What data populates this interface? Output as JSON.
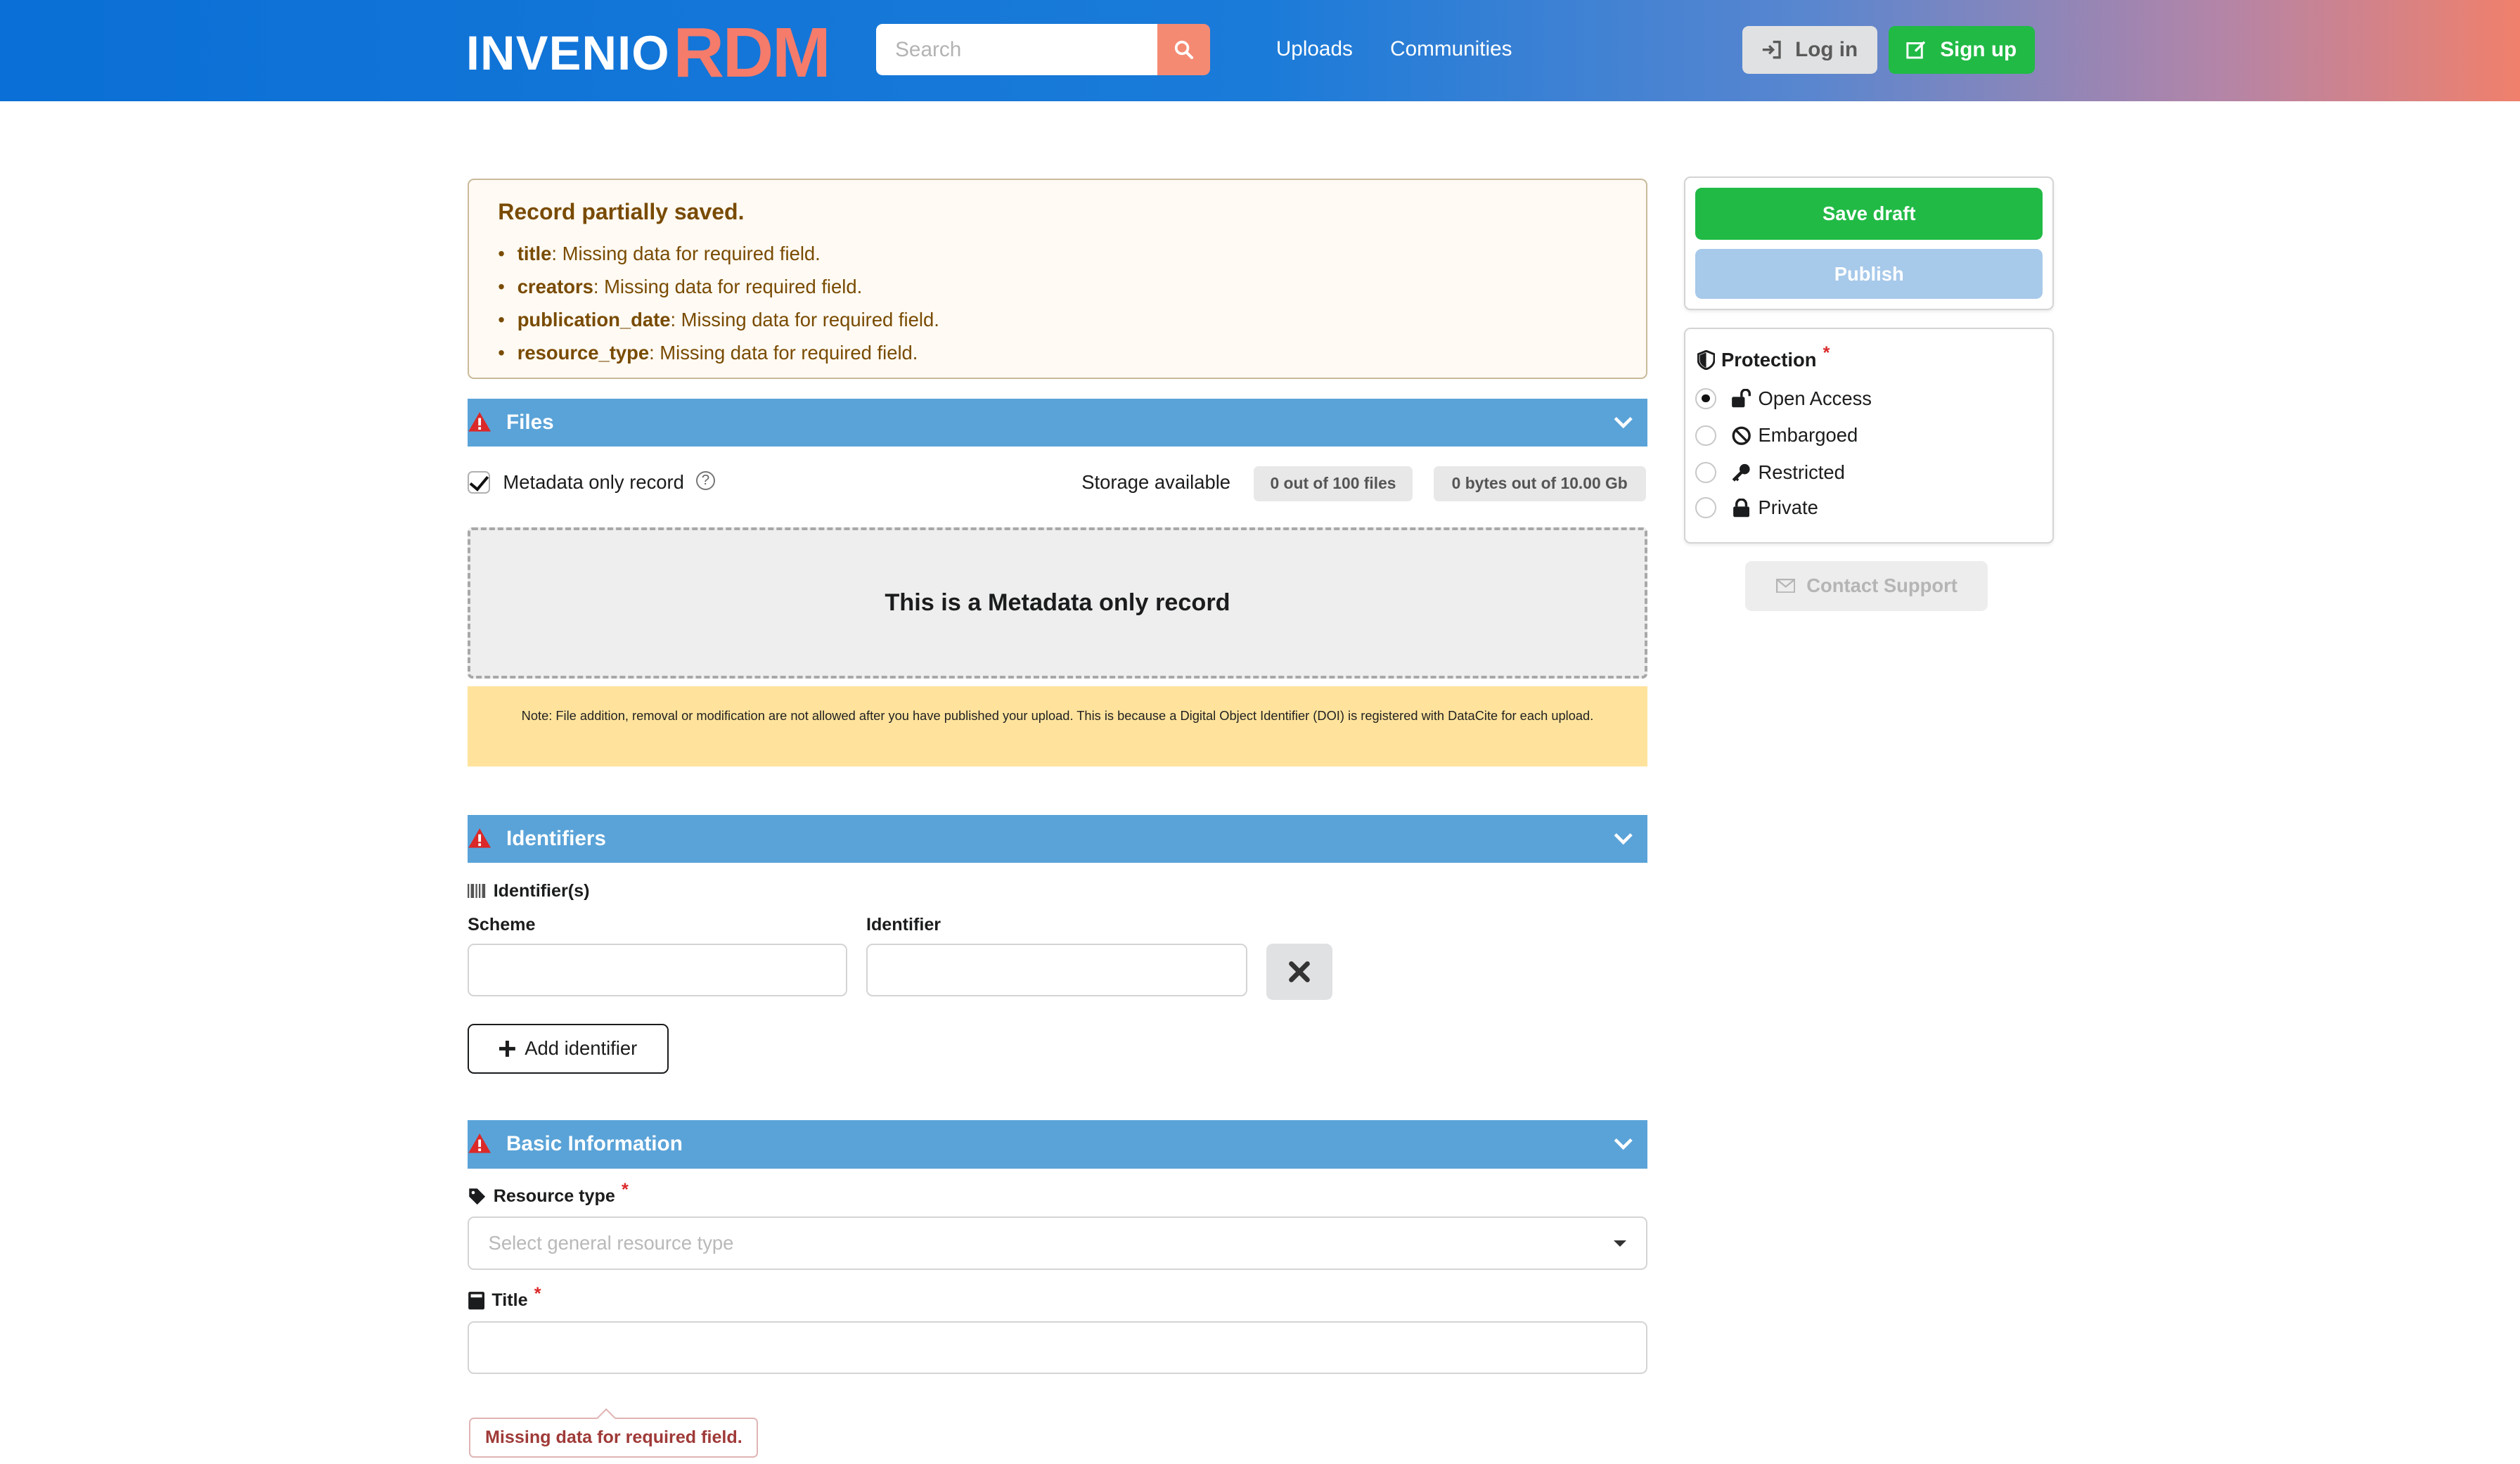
{
  "header": {
    "logo_main": "INVENIO",
    "logo_accent": "RDM",
    "search_placeholder": "Search",
    "nav": {
      "uploads": "Uploads",
      "communities": "Communities"
    },
    "login_label": "Log in",
    "signup_label": "Sign up"
  },
  "warning": {
    "title": "Record partially saved.",
    "items": [
      {
        "field": "title",
        "message": ": Missing data for required field."
      },
      {
        "field": "creators",
        "message": ": Missing data for required field."
      },
      {
        "field": "publication_date",
        "message": ": Missing data for required field."
      },
      {
        "field": "resource_type",
        "message": ": Missing data for required field."
      }
    ]
  },
  "files": {
    "section_title": "Files",
    "metadata_only_label": "Metadata only record",
    "metadata_only_checked": true,
    "storage_label": "Storage available",
    "files_chip": "0 out of 100 files",
    "size_chip": "0 bytes out of 10.00 Gb",
    "dropzone_text": "This is a Metadata only record",
    "note": "Note: File addition, removal or modification are not allowed after you have published your upload. This is because a Digital Object Identifier (DOI) is registered with DataCite for each upload."
  },
  "identifiers": {
    "section_title": "Identifiers",
    "group_label": "Identifier(s)",
    "scheme_label": "Scheme",
    "identifier_label": "Identifier",
    "scheme_value": "",
    "identifier_value": "",
    "add_label": "Add identifier"
  },
  "basic_info": {
    "section_title": "Basic Information",
    "resource_type_label": "Resource type",
    "resource_type_placeholder": "Select general resource type",
    "title_label": "Title",
    "title_value": "",
    "title_error": "Missing data for required field."
  },
  "sidebar": {
    "save_label": "Save draft",
    "publish_label": "Publish",
    "protection_label": "Protection",
    "options": [
      {
        "label": "Open Access",
        "selected": true
      },
      {
        "label": "Embargoed",
        "selected": false
      },
      {
        "label": "Restricted",
        "selected": false
      },
      {
        "label": "Private",
        "selected": false
      }
    ],
    "support_label": "Contact Support"
  },
  "colors": {
    "brand_blue": "#0a6fd6",
    "brand_coral": "#f57b6a",
    "section_blue": "#5aa3d8",
    "success_green": "#21ba45",
    "warning_text": "#794b02",
    "error_red": "#db2828"
  }
}
